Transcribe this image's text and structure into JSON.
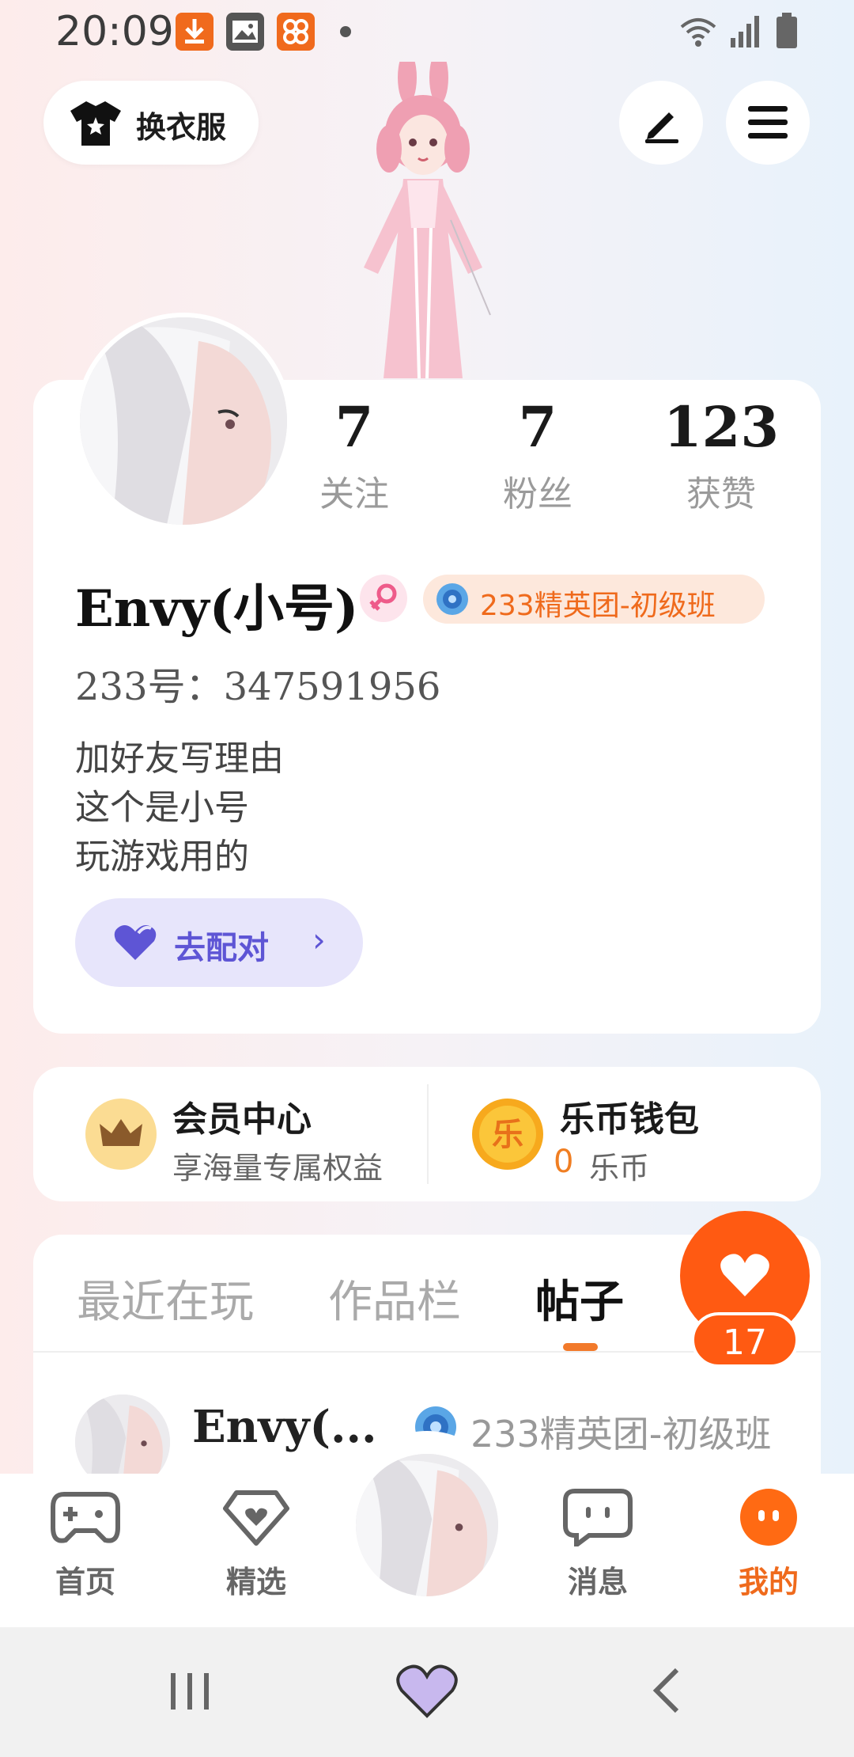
{
  "status_bar": {
    "time": "20:09"
  },
  "header": {
    "outfit_label": "换衣服"
  },
  "profile": {
    "stats": [
      {
        "value": "7",
        "label": "关注"
      },
      {
        "value": "7",
        "label": "粉丝"
      },
      {
        "value": "123",
        "label": "获赞"
      }
    ],
    "username": "Envy(小号)",
    "badge": "233精英团-初级班",
    "uid": "233号：347591956",
    "bio": [
      "加好友写理由",
      "这个是小号",
      "玩游戏用的"
    ],
    "match_button": "去配对"
  },
  "member": {
    "title": "会员中心",
    "subtitle": "享海量专属权益"
  },
  "wallet": {
    "title": "乐币钱包",
    "amount": "0",
    "unit": "乐币",
    "coin_glyph": "乐"
  },
  "tabs": [
    "最近在玩",
    "作品栏",
    "帖子"
  ],
  "active_tab": "帖子",
  "likes": "17",
  "post": {
    "author": "Envy(...",
    "badge": "233精英团-初级班"
  },
  "nav": [
    {
      "label": "首页",
      "icon": "gamepad-icon"
    },
    {
      "label": "精选",
      "icon": "heart-badge-icon"
    },
    {
      "label": "消息",
      "icon": "chat-icon"
    },
    {
      "label": "我的",
      "icon": "face-icon"
    }
  ],
  "colors": {
    "accent": "#ef6a1c",
    "match": "#5e55d5",
    "like": "#ff5a12"
  }
}
